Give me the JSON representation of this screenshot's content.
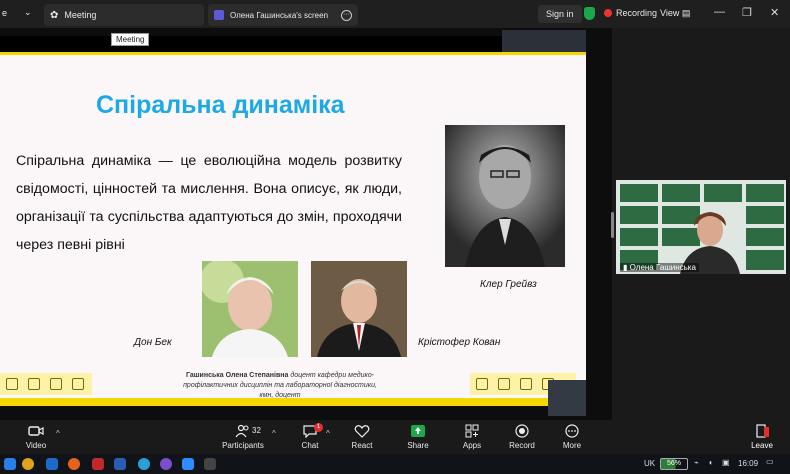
{
  "browser": {
    "tab1_label": "Meeting",
    "tab2_label": "Олена Гашинська's screen",
    "sign_in": "Sign in",
    "recording": "Recording",
    "view": "View"
  },
  "tooltip": "Meeting",
  "slide": {
    "title": "Спіральна динаміка",
    "body": "Спіральна динаміка — це еволюційна модель розвитку свідомості, цінностей та мислення. Вона описує, як люди, організації та суспільства адаптуються до змін, проходячи через певні рівні",
    "caption_graves": "Клер Грейвз",
    "caption_beck": "Дон Бек",
    "caption_cowan": "Крістофер Кован",
    "author_name": "Гашинська Олена Степанівна",
    "author_role": "доцент кафедри медико-профілактичних дисциплін та лабораторної діагностики, кмн, доцент"
  },
  "video": {
    "participant_name": "Олена Гашинська"
  },
  "toolbar": {
    "video": "Video",
    "participants": "Participants",
    "participants_count": "32",
    "chat": "Chat",
    "chat_badge": "1",
    "react": "React",
    "share": "Share",
    "apps": "Apps",
    "record": "Record",
    "more": "More",
    "leave": "Leave"
  },
  "taskbar": {
    "lang": "UK",
    "battery": "56%",
    "time": "16:09"
  },
  "colors": {
    "title_blue": "#1da9e6",
    "accent_yellow": "#f4d600",
    "share_green": "#19a84a",
    "leave_red": "#e03030"
  }
}
